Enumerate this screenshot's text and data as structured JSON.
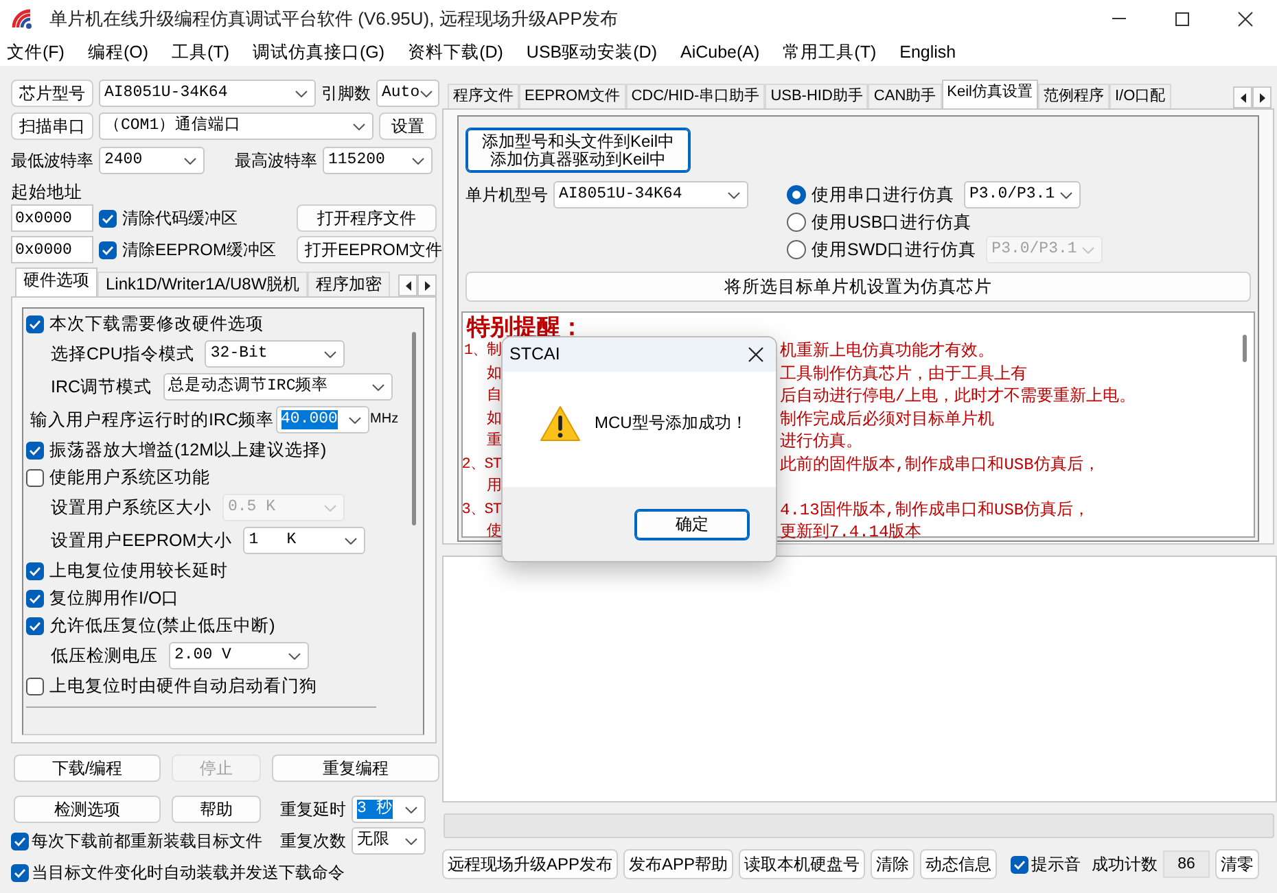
{
  "window": {
    "title": "单片机在线升级编程仿真调试平台软件 (V6.95U), 远程现场升级APP发布"
  },
  "menu": [
    "文件(F)",
    "编程(O)",
    "工具(T)",
    "调试仿真接口(G)",
    "资料下载(D)",
    "USB驱动安装(D)",
    "AiCube(A)",
    "常用工具(T)",
    "English"
  ],
  "chip": {
    "button": "芯片型号",
    "value": "AI8051U-34K64",
    "pins_label": "引脚数",
    "pins_value": "Auto"
  },
  "port": {
    "button": "扫描串口",
    "value": "（COM1）通信端口",
    "settings_button": "设置"
  },
  "baud": {
    "min_label": "最低波特率",
    "min_value": "2400",
    "max_label": "最高波特率",
    "max_value": "115200"
  },
  "start_address_label": "起始地址",
  "address_rows": [
    {
      "value": "0x0000",
      "checkbox_label": "清除代码缓冲区",
      "checked": true,
      "button": "打开程序文件"
    },
    {
      "value": "0x0000",
      "checkbox_label": "清除EEPROM缓冲区",
      "checked": true,
      "button": "打开EEPROM文件"
    }
  ],
  "left_tabs": [
    {
      "label": "硬件选项",
      "selected": true
    },
    {
      "label": "Link1D/Writer1A/U8W脱机",
      "selected": false
    },
    {
      "label": "程序加密",
      "selected": false
    }
  ],
  "hardware_options": [
    {
      "kind": "checkbox",
      "label": "本次下载需要修改硬件选项",
      "checked": true
    },
    {
      "kind": "select",
      "label": "选择CPU指令模式",
      "value": "32-Bit",
      "disabled": false
    },
    {
      "kind": "select",
      "label": "IRC调节模式",
      "value": "总是动态调节IRC频率",
      "disabled": false
    },
    {
      "kind": "input",
      "label": "输入用户程序运行时的IRC频率",
      "value": "40.000",
      "unit": "MHz",
      "text_selected": true
    },
    {
      "kind": "checkbox",
      "label": "振荡器放大增益(12M以上建议选择)",
      "checked": true
    },
    {
      "kind": "checkbox",
      "label": "使能用户系统区功能",
      "checked": false
    },
    {
      "kind": "select",
      "label": "设置用户系统区大小",
      "value": "0.5 K",
      "disabled": true
    },
    {
      "kind": "select",
      "label": "设置用户EEPROM大小",
      "value": "1   K",
      "disabled": false
    },
    {
      "kind": "checkbox",
      "label": "上电复位使用较长延时",
      "checked": true
    },
    {
      "kind": "checkbox",
      "label": "复位脚用作I/O口",
      "checked": true
    },
    {
      "kind": "checkbox",
      "label": "允许低压复位(禁止低压中断)",
      "checked": true
    },
    {
      "kind": "select",
      "label": "低压检测电压",
      "value": "2.00 V",
      "disabled": false
    },
    {
      "kind": "checkbox",
      "label": "上电复位时由硬件自动启动看门狗",
      "checked": false
    }
  ],
  "program_buttons": [
    {
      "label": "下载/编程",
      "disabled": false
    },
    {
      "label": "停止",
      "disabled": true
    },
    {
      "label": "重复编程",
      "disabled": false
    },
    {
      "label": "检测选项",
      "disabled": false
    },
    {
      "label": "帮助",
      "disabled": false
    }
  ],
  "repeat_delay": {
    "label": "重复延时",
    "value": "3 秒",
    "text_selected": true
  },
  "repeat_count": {
    "label": "重复次数",
    "value": "无限"
  },
  "auto_options": [
    {
      "label": "每次下载前都重新装载目标文件",
      "checked": true
    },
    {
      "label": "当目标文件变化时自动装载并发送下载命令",
      "checked": true
    }
  ],
  "right_tabs": [
    {
      "label": "程序文件",
      "selected": false
    },
    {
      "label": "EEPROM文件",
      "selected": false
    },
    {
      "label": "CDC/HID-串口助手",
      "selected": false
    },
    {
      "label": "USB-HID助手",
      "selected": false
    },
    {
      "label": "CAN助手",
      "selected": false
    },
    {
      "label": "Keil仿真设置",
      "selected": true
    },
    {
      "label": "范例程序",
      "selected": false
    },
    {
      "label": "I/O口配",
      "selected": false
    }
  ],
  "keil": {
    "add_button_lines": [
      "添加型号和头文件到Keil中",
      "添加仿真器驱动到Keil中"
    ],
    "mcu_label": "单片机型号",
    "mcu_value": "AI8051U-34K64",
    "debug_modes": [
      {
        "label": "使用串口进行仿真",
        "selected": true,
        "port": "P3.0/P3.1"
      },
      {
        "label": "使用USB口进行仿真",
        "selected": false
      },
      {
        "label": "使用SWD口进行仿真",
        "selected": false,
        "port": "P3.0/P3.1"
      }
    ],
    "set_button": "将所选目标单片机设置为仿真芯片",
    "notice": {
      "title": "特别提醒：",
      "lines": [
        {
          "left": "1、制",
          "right": "机重新上电仿真功能才有效。"
        },
        {
          "left": "如",
          "right": "工具制作仿真芯片，由于工具上有"
        },
        {
          "left": "自",
          "right": "后自动进行停电/上电，此时才不需要重新上电。"
        },
        {
          "left": "如",
          "right": "制作完成后必须对目标单片机"
        },
        {
          "left": "重",
          "right": "进行仿真。"
        },
        {
          "left": "2、ST",
          "right": "此前的固件版本,制作成串口和USB仿真后，"
        },
        {
          "left": "用"
        },
        {
          "left": "3、ST",
          "right": "4.13固件版本,制作成串口和USB仿真后，"
        },
        {
          "left": "使",
          "right": "更新到7.4.14版本"
        }
      ]
    }
  },
  "progress": {
    "level": 0
  },
  "bottom": {
    "buttons": [
      "远程现场升级APP发布",
      "发布APP帮助",
      "读取本机硬盘号",
      "清除",
      "动态信息"
    ],
    "sound": {
      "label": "提示音",
      "checked": true
    },
    "count_label": "成功计数",
    "count": "86",
    "reset_button": "清零"
  },
  "dialog": {
    "title": "STCAI",
    "message": "MCU型号添加成功！",
    "ok_button": "确定"
  }
}
